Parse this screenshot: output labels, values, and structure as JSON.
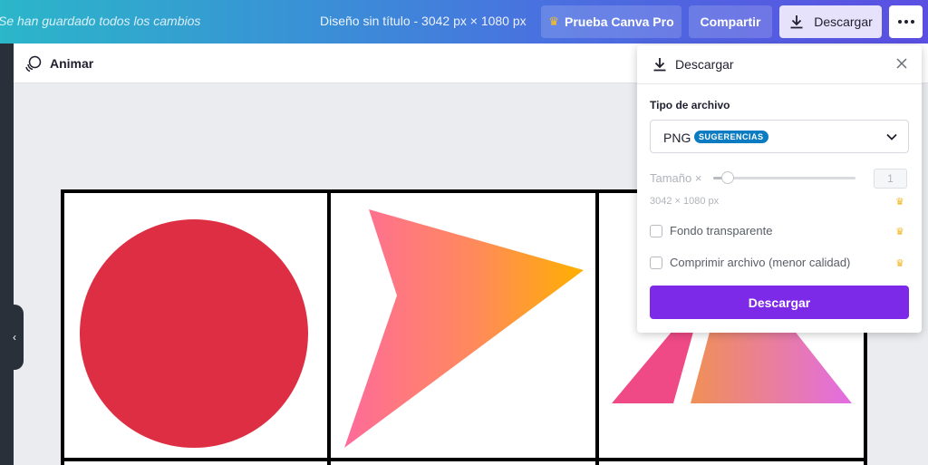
{
  "topbar": {
    "saved_status": "Se han guardado todos los cambios",
    "doc_title": "Diseño sin título - 3042 px × 1080 px",
    "pro_label": "Prueba Canva Pro",
    "share_label": "Compartir",
    "download_label": "Descargar"
  },
  "animbar": {
    "animate_label": "Animar"
  },
  "download_panel": {
    "title": "Descargar",
    "file_type_label": "Tipo de archivo",
    "file_type_value": "PNG",
    "file_type_badge": "SUGERENCIAS",
    "size_label": "Tamaño ×",
    "size_value": "1",
    "size_slider_fraction": 0.1,
    "dimensions": "3042 × 1080 px",
    "transparent_bg_label": "Fondo transparente",
    "transparent_bg_checked": false,
    "compress_label": "Comprimir archivo (menor calidad)",
    "compress_checked": false,
    "download_button": "Descargar"
  },
  "colors": {
    "brand_purple": "#7d2ae8",
    "badge_blue": "#0b7cc1",
    "crown": "#ffc21a",
    "circle_red": "#de2e43"
  },
  "icons": [
    "crown-icon",
    "download-icon",
    "more-dots-icon",
    "animate-icon",
    "close-icon",
    "chevron-down-icon",
    "chevron-left-icon"
  ]
}
